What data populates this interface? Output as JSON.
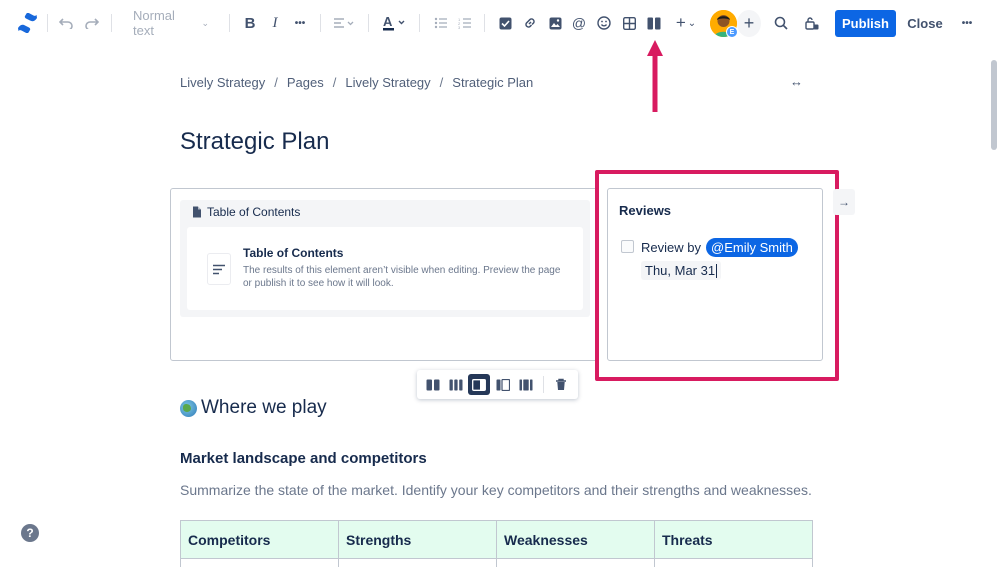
{
  "toolbar": {
    "logo": "confluence-logo",
    "text_style": "Normal text",
    "publish_label": "Publish",
    "close_label": "Close",
    "more_label": "•••",
    "text_more_label": "•••",
    "avatar_initial": "E",
    "invite_label": "+",
    "insert_label": "+"
  },
  "breadcrumb": {
    "items": [
      "Lively Strategy",
      "Pages",
      "Lively Strategy",
      "Strategic Plan"
    ],
    "separator": "/"
  },
  "width_toggle": "↔",
  "page": {
    "title": "Strategic Plan"
  },
  "toc": {
    "header": "Table of Contents",
    "title": "Table of Contents",
    "description": "The results of this element aren’t visible when editing. Preview the page or publish it to see how it will look."
  },
  "reviews": {
    "title": "Reviews",
    "task_prefix": "Review by",
    "mention": "@Emily Smith",
    "date": "Thu, Mar 31"
  },
  "sections": {
    "where_heading": "Where we play",
    "market_heading": "Market landscape and competitors",
    "market_desc": "Summarize the state of the market. Identify your key competitors and their strengths and weaknesses."
  },
  "table": {
    "headers": [
      "Competitors",
      "Strengths",
      "Weaknesses",
      "Threats"
    ]
  },
  "help_label": "?",
  "colors": {
    "accent": "#0c66e4",
    "annotation": "#d81b60",
    "table_header_bg": "#e3fcef"
  }
}
